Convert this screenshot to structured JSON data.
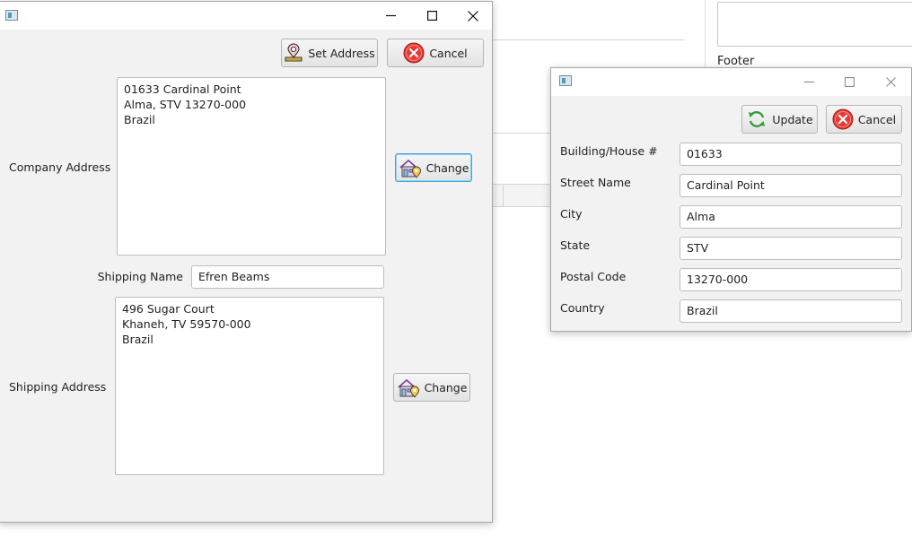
{
  "background": {
    "footer_label": "Footer"
  },
  "main_window": {
    "buttons": {
      "set_address": "Set Address",
      "cancel": "Cancel",
      "company_change": "Change",
      "shipping_change": "Change"
    },
    "labels": {
      "company_address": "Company Address",
      "shipping_name": "Shipping Name",
      "shipping_address": "Shipping Address"
    },
    "company_address_lines": [
      "01633 Cardinal Point",
      "Alma, STV 13270-000",
      "Brazil"
    ],
    "shipping_name_value": "Efren Beams",
    "shipping_address_lines": [
      "496 Sugar Court",
      "Khaneh, TV 59570-000",
      "Brazil"
    ]
  },
  "edit_window": {
    "buttons": {
      "update": "Update",
      "cancel": "Cancel"
    },
    "fields": [
      {
        "label": "Building/House #",
        "value": "01633"
      },
      {
        "label": "Street Name",
        "value": "Cardinal Point"
      },
      {
        "label": "City",
        "value": "Alma"
      },
      {
        "label": "State",
        "value": "STV"
      },
      {
        "label": "Postal Code",
        "value": "13270-000"
      },
      {
        "label": "Country",
        "value": "Brazil"
      }
    ]
  },
  "icons": {
    "app": "app-window-icon",
    "set_address": "map-pin-icon",
    "cancel": "cancel-x-icon",
    "change": "house-pin-icon",
    "update": "refresh-icon",
    "minimize": "minimize-icon",
    "maximize": "maximize-icon",
    "close": "close-icon"
  },
  "colors": {
    "window_bg": "#f2f2f2",
    "focus_border": "#3fa7d6",
    "cancel_red": "#e53935",
    "update_green": "#3a9a3a"
  }
}
